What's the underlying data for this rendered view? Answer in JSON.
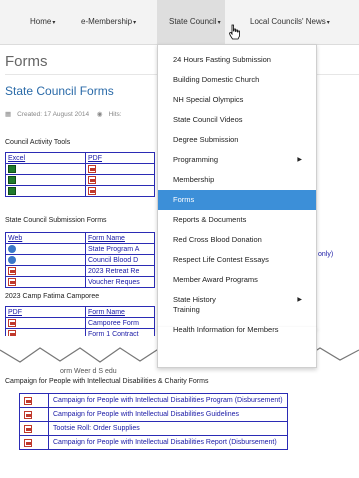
{
  "nav": {
    "items": [
      {
        "label": "Home"
      },
      {
        "label": "e-Membership"
      },
      {
        "label": "State Council"
      },
      {
        "label": "Local Councils' News"
      }
    ]
  },
  "page": {
    "title": "Forms",
    "article_title": "State Council Forms",
    "created": "Created: 17 August 2014",
    "hits": "Hits:"
  },
  "sections": {
    "activity_tools": "Council Activity Tools",
    "submission_forms": "State Council Submission Forms",
    "camporee": "2023 Camp Fatima Camporee",
    "campaign": "Campaign for People with Intellectual Disabilities & Charity Forms"
  },
  "tables": {
    "activity_header": [
      "Excel",
      "PDF"
    ],
    "submission_header": [
      "Web",
      "Form Name"
    ],
    "submission_rows": [
      "State Program A",
      "Council Blood D",
      "2023 Retreat Re",
      "Voucher Reques"
    ],
    "submission_suffix": "only)",
    "camporee_header": [
      "PDF",
      "Form Name"
    ],
    "camporee_rows": [
      "Camporee Form",
      "Form 1 Contract"
    ],
    "torn_text": "orm  Weer  d S  edu"
  },
  "campaign_rows": [
    "Campaign for People with Intellectual Disabilities Program (Disbursement)",
    "Campaign for People with Intellectual Disabilities Guidelines",
    "Tootsie Roll: Order Supplies",
    "Campaign for People with Intellectual Disabilities Report (Disbursement)"
  ],
  "dropdown": {
    "items": [
      {
        "label": "24 Hours Fasting Submission"
      },
      {
        "label": "Building Domestic Church"
      },
      {
        "label": "NH Special Olympics"
      },
      {
        "label": "State Council Videos"
      },
      {
        "label": "Degree Submission"
      },
      {
        "label": "Programming"
      },
      {
        "label": "Membership"
      },
      {
        "label": "Forms"
      },
      {
        "label": "Reports & Documents"
      },
      {
        "label": "Red Cross Blood Donation"
      },
      {
        "label": "Respect Life Contest Essays"
      },
      {
        "label": "Member Award Programs"
      },
      {
        "label": "State History"
      },
      {
        "label": "Training"
      },
      {
        "label": "Health Information for Members"
      }
    ],
    "active": "Forms"
  },
  "colors": {
    "accent": "#3c8fd8",
    "link": "#2a6aa8",
    "table_border": "#2b2bb5"
  }
}
